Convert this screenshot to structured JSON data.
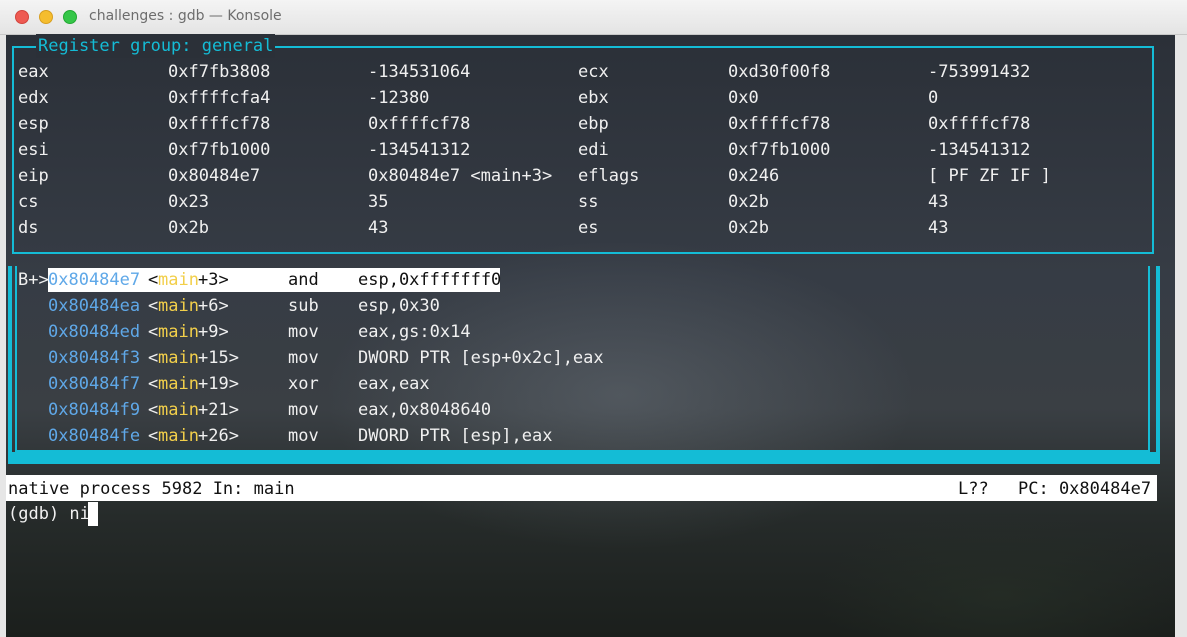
{
  "window": {
    "title": "challenges : gdb — Konsole",
    "controls": [
      "close",
      "minimize",
      "maximize"
    ]
  },
  "colors": {
    "accent": "#14bcd6",
    "address": "#5fa8e8",
    "symbol": "#f2cf4a"
  },
  "registers": {
    "title": "Register group: general",
    "rows": [
      {
        "n1": "eax",
        "h1": "0xf7fb3808",
        "v1": "-134531064",
        "n2": "ecx",
        "h2": "0xd30f00f8",
        "v2": "-753991432"
      },
      {
        "n1": "edx",
        "h1": "0xffffcfa4",
        "v1": "-12380",
        "n2": "ebx",
        "h2": "0x0",
        "v2": "0"
      },
      {
        "n1": "esp",
        "h1": "0xffffcf78",
        "v1": "0xffffcf78",
        "n2": "ebp",
        "h2": "0xffffcf78",
        "v2": "0xffffcf78"
      },
      {
        "n1": "esi",
        "h1": "0xf7fb1000",
        "v1": "-134541312",
        "n2": "edi",
        "h2": "0xf7fb1000",
        "v2": "-134541312"
      },
      {
        "n1": "eip",
        "h1": "0x80484e7",
        "v1": "0x80484e7 <main+3>",
        "n2": "eflags",
        "h2": "0x246",
        "v2": "[ PF ZF IF ]"
      },
      {
        "n1": "cs",
        "h1": "0x23",
        "v1": "35",
        "n2": "ss",
        "h2": "0x2b",
        "v2": "43"
      },
      {
        "n1": "ds",
        "h1": "0x2b",
        "v1": "43",
        "n2": "es",
        "h2": "0x2b",
        "v2": "43"
      }
    ]
  },
  "asm": {
    "marker": "B+>",
    "rows": [
      {
        "addr": "0x80484e7",
        "lt": "<",
        "sym": "main",
        "off": "+3>",
        "op": "and",
        "args": "esp,0xfffffff0"
      },
      {
        "addr": "0x80484ea",
        "lt": "<",
        "sym": "main",
        "off": "+6>",
        "op": "sub",
        "args": "esp,0x30"
      },
      {
        "addr": "0x80484ed",
        "lt": "<",
        "sym": "main",
        "off": "+9>",
        "op": "mov",
        "args": "eax,gs:0x14"
      },
      {
        "addr": "0x80484f3",
        "lt": "<",
        "sym": "main",
        "off": "+15>",
        "op": "mov",
        "args": "DWORD PTR [esp+0x2c],eax"
      },
      {
        "addr": "0x80484f7",
        "lt": "<",
        "sym": "main",
        "off": "+19>",
        "op": "xor",
        "args": "eax,eax"
      },
      {
        "addr": "0x80484f9",
        "lt": "<",
        "sym": "main",
        "off": "+21>",
        "op": "mov",
        "args": "eax,0x8048640"
      },
      {
        "addr": "0x80484fe",
        "lt": "<",
        "sym": "main",
        "off": "+26>",
        "op": "mov",
        "args": "DWORD PTR [esp],eax"
      }
    ]
  },
  "status": {
    "left": "native process 5982 In: main",
    "line": "L??",
    "pc": "PC: 0x80484e7"
  },
  "prompt": {
    "text": "(gdb) ni"
  }
}
